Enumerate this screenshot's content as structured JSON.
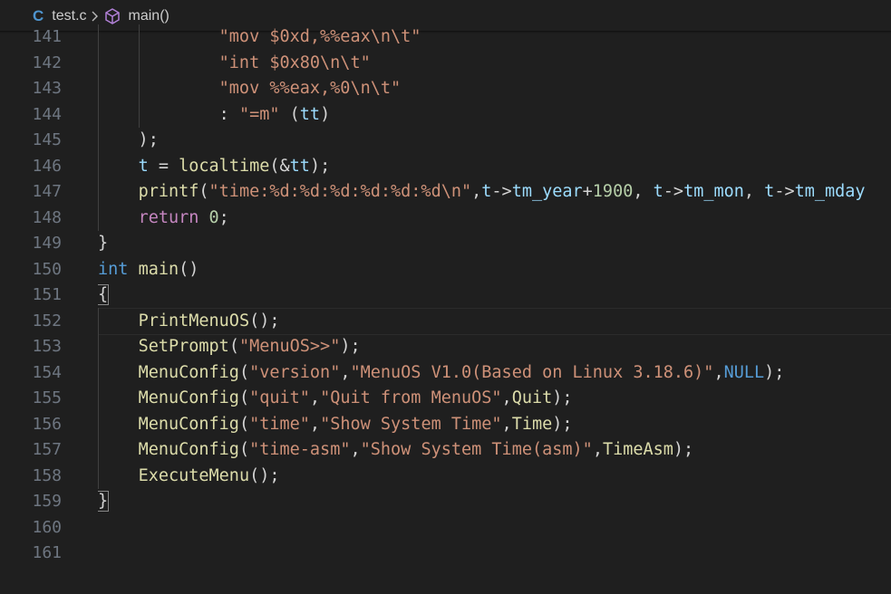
{
  "breadcrumb": {
    "c_label": "C",
    "file": "test.c",
    "symbol": "main()"
  },
  "gutter": [
    "141",
    "142",
    "143",
    "144",
    "145",
    "146",
    "147",
    "148",
    "149",
    "150",
    "151",
    "152",
    "153",
    "154",
    "155",
    "156",
    "157",
    "158",
    "159",
    "160",
    "161"
  ],
  "lines": [
    [
      {
        "t": "            \"mov $0xd,%%eax\\n\\t\"",
        "c": "str"
      }
    ],
    [
      {
        "t": "            \"int $0x80\\n\\t\"",
        "c": "str"
      }
    ],
    [
      {
        "t": "            \"mov %%eax,%0\\n\\t\"",
        "c": "str"
      }
    ],
    [
      {
        "t": "            : ",
        "c": "plain"
      },
      {
        "t": "\"=m\"",
        "c": "str"
      },
      {
        "t": " (",
        "c": "plain"
      },
      {
        "t": "tt",
        "c": "var"
      },
      {
        "t": ")",
        "c": "plain"
      }
    ],
    [
      {
        "t": "    );",
        "c": "plain"
      }
    ],
    [
      {
        "t": "    ",
        "c": "plain"
      },
      {
        "t": "t",
        "c": "var"
      },
      {
        "t": " = ",
        "c": "plain"
      },
      {
        "t": "localtime",
        "c": "fn"
      },
      {
        "t": "(&",
        "c": "plain"
      },
      {
        "t": "tt",
        "c": "var"
      },
      {
        "t": ");",
        "c": "plain"
      }
    ],
    [
      {
        "t": "    ",
        "c": "plain"
      },
      {
        "t": "printf",
        "c": "fn"
      },
      {
        "t": "(",
        "c": "plain"
      },
      {
        "t": "\"time:%d:%d:%d:%d:%d:%d\\n\"",
        "c": "str"
      },
      {
        "t": ",",
        "c": "plain"
      },
      {
        "t": "t",
        "c": "var"
      },
      {
        "t": "->",
        "c": "plain"
      },
      {
        "t": "tm_year",
        "c": "var"
      },
      {
        "t": "+",
        "c": "plain"
      },
      {
        "t": "1900",
        "c": "num"
      },
      {
        "t": ", ",
        "c": "plain"
      },
      {
        "t": "t",
        "c": "var"
      },
      {
        "t": "->",
        "c": "plain"
      },
      {
        "t": "tm_mon",
        "c": "var"
      },
      {
        "t": ", ",
        "c": "plain"
      },
      {
        "t": "t",
        "c": "var"
      },
      {
        "t": "->",
        "c": "plain"
      },
      {
        "t": "tm_mday",
        "c": "var"
      }
    ],
    [
      {
        "t": "    ",
        "c": "plain"
      },
      {
        "t": "return",
        "c": "ctl"
      },
      {
        "t": " ",
        "c": "plain"
      },
      {
        "t": "0",
        "c": "num"
      },
      {
        "t": ";",
        "c": "plain"
      }
    ],
    [
      {
        "t": "}",
        "c": "plain"
      }
    ],
    [
      {
        "t": "int",
        "c": "kw"
      },
      {
        "t": " ",
        "c": "plain"
      },
      {
        "t": "main",
        "c": "fn"
      },
      {
        "t": "()",
        "c": "plain"
      }
    ],
    [
      {
        "t": "{",
        "c": "plain",
        "b": true
      }
    ],
    [
      {
        "t": "    ",
        "c": "plain"
      },
      {
        "t": "PrintMenuOS",
        "c": "fn"
      },
      {
        "t": "();",
        "c": "plain"
      }
    ],
    [
      {
        "t": "    ",
        "c": "plain"
      },
      {
        "t": "SetPrompt",
        "c": "fn"
      },
      {
        "t": "(",
        "c": "plain"
      },
      {
        "t": "\"MenuOS>>\"",
        "c": "str"
      },
      {
        "t": ");",
        "c": "plain"
      }
    ],
    [
      {
        "t": "    ",
        "c": "plain"
      },
      {
        "t": "MenuConfig",
        "c": "fn"
      },
      {
        "t": "(",
        "c": "plain"
      },
      {
        "t": "\"version\"",
        "c": "str"
      },
      {
        "t": ",",
        "c": "plain"
      },
      {
        "t": "\"MenuOS V1.0(Based on Linux 3.18.6)\"",
        "c": "str"
      },
      {
        "t": ",",
        "c": "plain"
      },
      {
        "t": "NULL",
        "c": "const"
      },
      {
        "t": ");",
        "c": "plain"
      }
    ],
    [
      {
        "t": "    ",
        "c": "plain"
      },
      {
        "t": "MenuConfig",
        "c": "fn"
      },
      {
        "t": "(",
        "c": "plain"
      },
      {
        "t": "\"quit\"",
        "c": "str"
      },
      {
        "t": ",",
        "c": "plain"
      },
      {
        "t": "\"Quit from MenuOS\"",
        "c": "str"
      },
      {
        "t": ",",
        "c": "plain"
      },
      {
        "t": "Quit",
        "c": "fn"
      },
      {
        "t": ");",
        "c": "plain"
      }
    ],
    [
      {
        "t": "    ",
        "c": "plain"
      },
      {
        "t": "MenuConfig",
        "c": "fn"
      },
      {
        "t": "(",
        "c": "plain"
      },
      {
        "t": "\"time\"",
        "c": "str"
      },
      {
        "t": ",",
        "c": "plain"
      },
      {
        "t": "\"Show System Time\"",
        "c": "str"
      },
      {
        "t": ",",
        "c": "plain"
      },
      {
        "t": "Time",
        "c": "fn"
      },
      {
        "t": ");",
        "c": "plain"
      }
    ],
    [
      {
        "t": "    ",
        "c": "plain"
      },
      {
        "t": "MenuConfig",
        "c": "fn"
      },
      {
        "t": "(",
        "c": "plain"
      },
      {
        "t": "\"time-asm\"",
        "c": "str"
      },
      {
        "t": ",",
        "c": "plain"
      },
      {
        "t": "\"Show System Time(asm)\"",
        "c": "str"
      },
      {
        "t": ",",
        "c": "plain"
      },
      {
        "t": "TimeAsm",
        "c": "fn"
      },
      {
        "t": ");",
        "c": "plain"
      }
    ],
    [
      {
        "t": "    ",
        "c": "plain"
      },
      {
        "t": "ExecuteMenu",
        "c": "fn"
      },
      {
        "t": "();",
        "c": "plain"
      }
    ],
    [
      {
        "t": "}",
        "c": "plain",
        "b": true
      }
    ],
    [],
    []
  ],
  "current_line_index": 11
}
